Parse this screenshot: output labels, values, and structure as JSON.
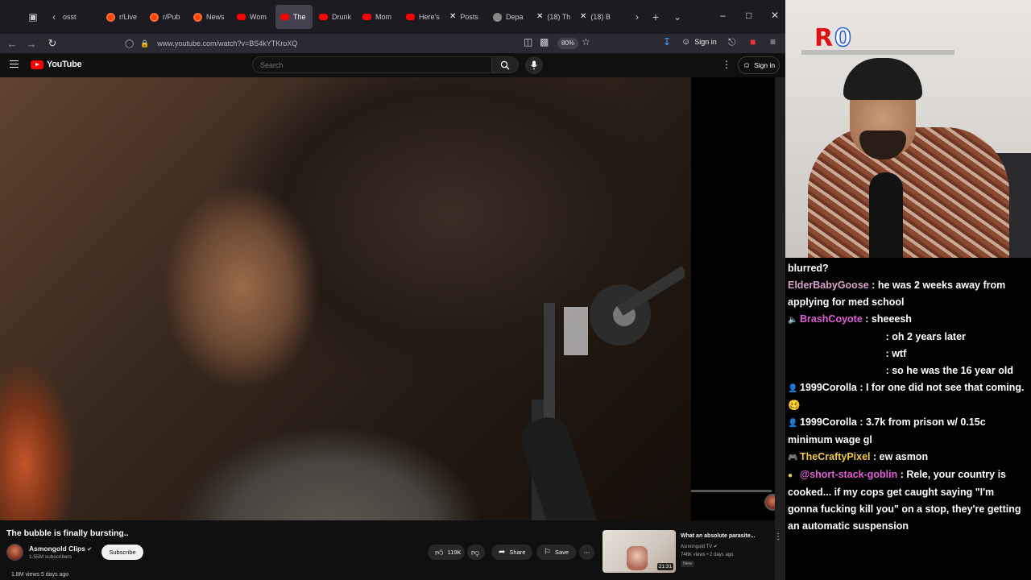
{
  "browser": {
    "tabs": [
      {
        "label": "osst",
        "icon": "tab-overflow-icon",
        "fav": "none",
        "active": false
      },
      {
        "label": "r/Live",
        "icon": "reddit-icon",
        "fav": "reddit",
        "active": false
      },
      {
        "label": "r/Pub",
        "icon": "reddit-icon",
        "fav": "reddit",
        "active": false
      },
      {
        "label": "News",
        "icon": "reddit-icon",
        "fav": "reddit",
        "active": false
      },
      {
        "label": "Wom",
        "icon": "youtube-icon",
        "fav": "yt",
        "active": false
      },
      {
        "label": "The",
        "icon": "youtube-icon",
        "fav": "yt",
        "active": true
      },
      {
        "label": "Drunk",
        "icon": "youtube-icon",
        "fav": "yt",
        "active": false
      },
      {
        "label": "Mom",
        "icon": "youtube-icon",
        "fav": "yt",
        "active": false
      },
      {
        "label": "Here's",
        "icon": "youtube-icon",
        "fav": "yt",
        "active": false
      },
      {
        "label": "Posts",
        "icon": "x-icon",
        "fav": "x",
        "active": false
      },
      {
        "label": "Depa",
        "icon": "globe-icon",
        "fav": "g",
        "active": false
      },
      {
        "label": "(18) Th",
        "icon": "x-icon",
        "fav": "x",
        "active": false
      },
      {
        "label": "(18) B",
        "icon": "x-icon",
        "fav": "x",
        "active": false
      }
    ],
    "url": "www.youtube.com/watch?v=BS4kYTKroXQ",
    "zoom": "80%",
    "signin": "Sign in"
  },
  "youtube": {
    "logo_text": "YouTube",
    "search_placeholder": "Search",
    "signin": "Sign in",
    "video": {
      "title": "The bubble is finally bursting..",
      "channel": "Asmongold Clips",
      "subscribers": "1.55M subscribers",
      "subscribe_label": "Subscribe",
      "likes": "119K",
      "share_label": "Share",
      "save_label": "Save",
      "views": "1.8M views  5 days ago"
    },
    "recommended": {
      "title": "What an absolute parasite...",
      "channel": "Asmongold TV",
      "meta": "748K views • 2 days ago",
      "badge": "New",
      "duration": "21:31"
    }
  },
  "stream_overlay": {
    "logo_r": "R",
    "logo_0": "0"
  },
  "chat": [
    {
      "user": "",
      "text": "blurred?",
      "color": "#ffffff",
      "badge": ""
    },
    {
      "user": "ElderBabyGoose",
      "text": " : he was 2 weeks away from applying for med school",
      "color": "#d9a3c9",
      "badge": ""
    },
    {
      "user": "BrashCoyote",
      "text": " : sheeesh",
      "color": "#e05ed6",
      "badge": "🔈"
    },
    {
      "user": "",
      "text": "                                   : oh 2 years later",
      "color": "#ffffff",
      "badge": ""
    },
    {
      "user": "",
      "text": "                                   : wtf",
      "color": "#ffffff",
      "badge": ""
    },
    {
      "user": "",
      "text": "                                   : so he was the 16 year old",
      "color": "#ffffff",
      "badge": ""
    },
    {
      "user": "1999Corolla",
      "text": " : I for one did not see that coming. 🥴",
      "color": "#ffffff",
      "badge": "👤"
    },
    {
      "user": "1999Corolla",
      "text": " : 3.7k from prison w/ 0.15c minimum wage gl",
      "color": "#ffffff",
      "badge": "👤"
    },
    {
      "user": "TheCraftyPixel",
      "text": " : ew asmon",
      "color": "#f0c84a",
      "badge": "🎮"
    },
    {
      "user": "@short-stack-goblin",
      "text": " : Rele, your country is cooked... if my cops get caught saying \"I'm gonna fucking kill you\" on a stop, they're getting an automatic suspension",
      "color": "#e05ed6",
      "badge": "●"
    }
  ]
}
